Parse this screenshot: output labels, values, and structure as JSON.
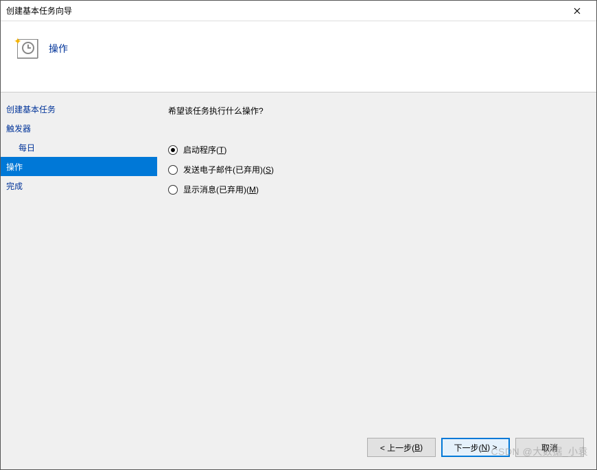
{
  "window": {
    "title": "创建基本任务向导"
  },
  "header": {
    "title": "操作"
  },
  "sidebar": {
    "items": [
      {
        "label": "创建基本任务",
        "indent": false,
        "selected": false
      },
      {
        "label": "触发器",
        "indent": false,
        "selected": false
      },
      {
        "label": "每日",
        "indent": true,
        "selected": false
      },
      {
        "label": "操作",
        "indent": false,
        "selected": true
      },
      {
        "label": "完成",
        "indent": false,
        "selected": false
      }
    ]
  },
  "main": {
    "prompt": "希望该任务执行什么操作?",
    "options": [
      {
        "label_pre": "启动程序(",
        "hotkey": "T",
        "label_post": ")",
        "checked": true
      },
      {
        "label_pre": "发送电子邮件(已弃用)(",
        "hotkey": "S",
        "label_post": ")",
        "checked": false
      },
      {
        "label_pre": "显示消息(已弃用)(",
        "hotkey": "M",
        "label_post": ")",
        "checked": false
      }
    ]
  },
  "buttons": {
    "back_pre": "< 上一步(",
    "back_hot": "B",
    "back_post": ")",
    "next_pre": "下一步(",
    "next_hot": "N",
    "next_post": ") >",
    "cancel": "取消"
  },
  "watermark": "CSDN @大数据_小袁"
}
